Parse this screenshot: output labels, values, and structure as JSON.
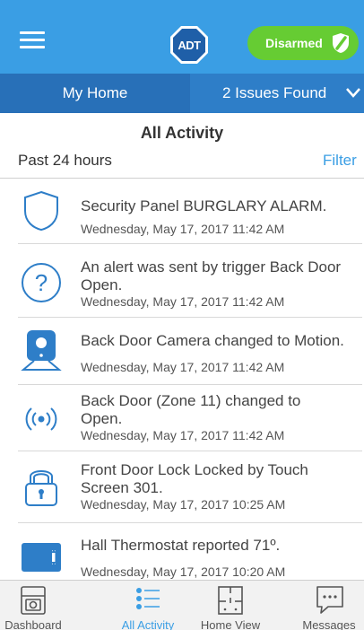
{
  "header": {
    "logo_text": "ADT",
    "status_button": "Disarmed"
  },
  "tabs": {
    "home": "My Home",
    "issues": "2 Issues Found"
  },
  "activity": {
    "title": "All Activity",
    "range": "Past 24 hours",
    "filter": "Filter",
    "items": [
      {
        "icon": "shield-icon",
        "line1": "Security Panel BURGLARY ALARM.",
        "line2": "",
        "time": "Wednesday, May 17, 2017   11:42 AM"
      },
      {
        "icon": "question-icon",
        "line1": "An alert was sent by trigger Back Door",
        "line2": "Open.",
        "time": "Wednesday, May 17, 2017   11:42 AM"
      },
      {
        "icon": "camera-icon",
        "line1": "Back Door Camera changed to Motion.",
        "line2": "",
        "time": "Wednesday, May 17, 2017   11:42 AM"
      },
      {
        "icon": "sensor-icon",
        "line1": "Back Door (Zone 11) changed to",
        "line2": "Open.",
        "time": "Wednesday, May 17, 2017   11:42 AM"
      },
      {
        "icon": "lock-icon",
        "line1": "Front Door Lock Locked by Touch",
        "line2": "Screen 301.",
        "time": "Wednesday, May 17, 2017   10:25 AM"
      },
      {
        "icon": "thermostat-icon",
        "line1": "Hall Thermostat reported 71º.",
        "line2": "",
        "time": "Wednesday, May 17, 2017   10:20 AM"
      }
    ]
  },
  "nav": {
    "dashboard": "Dashboard",
    "activity": "All Activity",
    "home_view": "Home View",
    "messages": "Messages"
  },
  "colors": {
    "header": "#3a9ee4",
    "tab_active": "#2870b8",
    "disarmed": "#66cc33",
    "accent": "#3a9ee4"
  }
}
